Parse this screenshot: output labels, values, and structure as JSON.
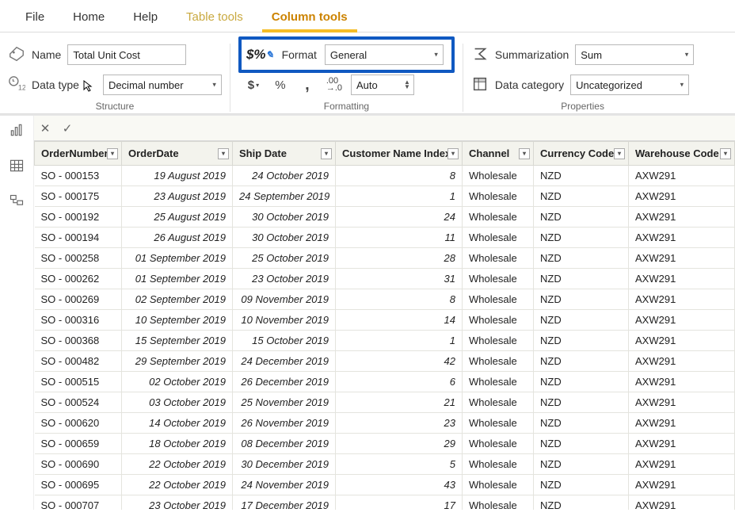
{
  "menu": {
    "file": "File",
    "home": "Home",
    "help": "Help",
    "tabletools": "Table tools",
    "columntools": "Column tools"
  },
  "structure": {
    "nameLabel": "Name",
    "nameValue": "Total Unit Cost",
    "dtLabel": "Data type",
    "dtValue": "Decimal number",
    "group": "Structure"
  },
  "formatting": {
    "formatLabel": "Format",
    "formatValue": "General",
    "currency": "$",
    "percent": "%",
    "comma": ",",
    "decshift": ".00→.0",
    "autoLabel": "Auto",
    "group": "Formatting"
  },
  "properties": {
    "sumLabel": "Summarization",
    "sumValue": "Sum",
    "catLabel": "Data category",
    "catValue": "Uncategorized",
    "group": "Properties"
  },
  "fbar": {
    "cancel": "✕",
    "commit": "✓",
    "value": ""
  },
  "columns": [
    "OrderNumber",
    "OrderDate",
    "Ship Date",
    "Customer Name Index",
    "Channel",
    "Currency Code",
    "Warehouse Code"
  ],
  "rows": [
    {
      "on": "SO - 000153",
      "od": "19 August 2019",
      "sd": "24 October 2019",
      "ci": "8",
      "ch": "Wholesale",
      "cc": "NZD",
      "wc": "AXW291"
    },
    {
      "on": "SO - 000175",
      "od": "23 August 2019",
      "sd": "24 September 2019",
      "ci": "1",
      "ch": "Wholesale",
      "cc": "NZD",
      "wc": "AXW291"
    },
    {
      "on": "SO - 000192",
      "od": "25 August 2019",
      "sd": "30 October 2019",
      "ci": "24",
      "ch": "Wholesale",
      "cc": "NZD",
      "wc": "AXW291"
    },
    {
      "on": "SO - 000194",
      "od": "26 August 2019",
      "sd": "30 October 2019",
      "ci": "11",
      "ch": "Wholesale",
      "cc": "NZD",
      "wc": "AXW291"
    },
    {
      "on": "SO - 000258",
      "od": "01 September 2019",
      "sd": "25 October 2019",
      "ci": "28",
      "ch": "Wholesale",
      "cc": "NZD",
      "wc": "AXW291"
    },
    {
      "on": "SO - 000262",
      "od": "01 September 2019",
      "sd": "23 October 2019",
      "ci": "31",
      "ch": "Wholesale",
      "cc": "NZD",
      "wc": "AXW291"
    },
    {
      "on": "SO - 000269",
      "od": "02 September 2019",
      "sd": "09 November 2019",
      "ci": "8",
      "ch": "Wholesale",
      "cc": "NZD",
      "wc": "AXW291"
    },
    {
      "on": "SO - 000316",
      "od": "10 September 2019",
      "sd": "10 November 2019",
      "ci": "14",
      "ch": "Wholesale",
      "cc": "NZD",
      "wc": "AXW291"
    },
    {
      "on": "SO - 000368",
      "od": "15 September 2019",
      "sd": "15 October 2019",
      "ci": "1",
      "ch": "Wholesale",
      "cc": "NZD",
      "wc": "AXW291"
    },
    {
      "on": "SO - 000482",
      "od": "29 September 2019",
      "sd": "24 December 2019",
      "ci": "42",
      "ch": "Wholesale",
      "cc": "NZD",
      "wc": "AXW291"
    },
    {
      "on": "SO - 000515",
      "od": "02 October 2019",
      "sd": "26 December 2019",
      "ci": "6",
      "ch": "Wholesale",
      "cc": "NZD",
      "wc": "AXW291"
    },
    {
      "on": "SO - 000524",
      "od": "03 October 2019",
      "sd": "25 November 2019",
      "ci": "21",
      "ch": "Wholesale",
      "cc": "NZD",
      "wc": "AXW291"
    },
    {
      "on": "SO - 000620",
      "od": "14 October 2019",
      "sd": "26 November 2019",
      "ci": "23",
      "ch": "Wholesale",
      "cc": "NZD",
      "wc": "AXW291"
    },
    {
      "on": "SO - 000659",
      "od": "18 October 2019",
      "sd": "08 December 2019",
      "ci": "29",
      "ch": "Wholesale",
      "cc": "NZD",
      "wc": "AXW291"
    },
    {
      "on": "SO - 000690",
      "od": "22 October 2019",
      "sd": "30 December 2019",
      "ci": "5",
      "ch": "Wholesale",
      "cc": "NZD",
      "wc": "AXW291"
    },
    {
      "on": "SO - 000695",
      "od": "22 October 2019",
      "sd": "24 November 2019",
      "ci": "43",
      "ch": "Wholesale",
      "cc": "NZD",
      "wc": "AXW291"
    },
    {
      "on": "SO - 000707",
      "od": "23 October 2019",
      "sd": "17 December 2019",
      "ci": "17",
      "ch": "Wholesale",
      "cc": "NZD",
      "wc": "AXW291"
    }
  ]
}
